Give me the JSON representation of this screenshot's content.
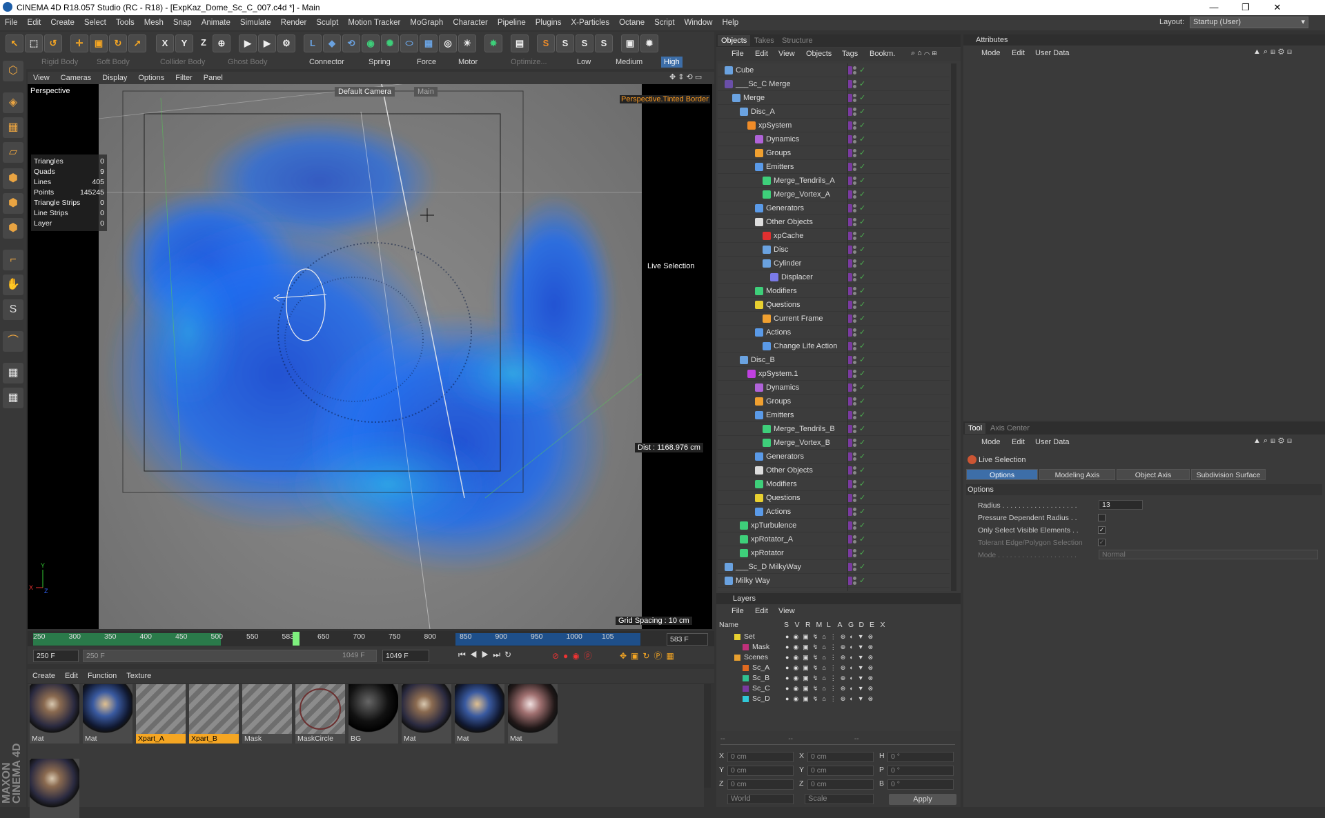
{
  "window": {
    "title": "CINEMA 4D R18.057 Studio (RC - R18) - [ExpKaz_Dome_Sc_C_007.c4d *] - Main"
  },
  "menu": [
    "File",
    "Edit",
    "Create",
    "Select",
    "Tools",
    "Mesh",
    "Snap",
    "Animate",
    "Simulate",
    "Render",
    "Sculpt",
    "Motion Tracker",
    "MoGraph",
    "Character",
    "Pipeline",
    "Plugins",
    "X-Particles",
    "Octane",
    "Script",
    "Window",
    "Help"
  ],
  "layout": {
    "label": "Layout:",
    "value": "Startup (User)"
  },
  "toolbar2": {
    "rigid_body": "Rigid Body",
    "soft_body": "Soft Body",
    "collider_body": "Collider Body",
    "ghost_body": "Ghost Body",
    "connector": "Connector",
    "spring": "Spring",
    "force": "Force",
    "motor": "Motor",
    "optimize": "Optimize...",
    "low": "Low",
    "medium": "Medium",
    "high": "High"
  },
  "viewport": {
    "menu": [
      "View",
      "Cameras",
      "Display",
      "Options",
      "Filter",
      "Panel"
    ],
    "name": "Perspective",
    "camera": "Default Camera",
    "main_label": "Main",
    "border_label": "Perspective.Tinted Border",
    "tool_hint": "Live Selection",
    "distance": "Dist : 1168.976 cm",
    "grid_spacing": "Grid Spacing : 10 cm",
    "stats": [
      {
        "label": "Triangles",
        "value": "0"
      },
      {
        "label": "Quads",
        "value": "9"
      },
      {
        "label": "Lines",
        "value": "405"
      },
      {
        "label": "Points",
        "value": "145245"
      },
      {
        "label": "Triangle Strips",
        "value": "0"
      },
      {
        "label": "Line Strips",
        "value": "0"
      },
      {
        "label": "Layer",
        "value": "0"
      }
    ]
  },
  "timeline": {
    "ticks": [
      "250",
      "300",
      "350",
      "400",
      "450",
      "500",
      "550",
      "583",
      "650",
      "700",
      "750",
      "800",
      "850",
      "900",
      "950",
      "1000",
      "105"
    ],
    "current_frame": "583 F",
    "start": "250 F",
    "range_start": "250 F",
    "range_end": "1049 F",
    "end": "1049 F"
  },
  "materials": {
    "menu": [
      "Create",
      "Edit",
      "Function",
      "Texture"
    ],
    "items": [
      {
        "name": "Mat",
        "selected": false,
        "style": "galaxy"
      },
      {
        "name": "Mat",
        "selected": false,
        "style": "galaxy-blue"
      },
      {
        "name": "Xpart_A",
        "selected": true,
        "style": "hatch"
      },
      {
        "name": "Xpart_B",
        "selected": true,
        "style": "hatch"
      },
      {
        "name": "Mask",
        "selected": false,
        "style": "hatch"
      },
      {
        "name": "MaskCircle",
        "selected": false,
        "style": "hatch-ring"
      },
      {
        "name": "BG",
        "selected": false,
        "style": "black"
      },
      {
        "name": "Mat",
        "selected": false,
        "style": "galaxy"
      },
      {
        "name": "Mat",
        "selected": false,
        "style": "galaxy-blue"
      },
      {
        "name": "Mat",
        "selected": false,
        "style": "galaxy-red"
      },
      {
        "name": "",
        "selected": false,
        "style": "galaxy"
      }
    ]
  },
  "objects_panel": {
    "tabs": [
      "Objects",
      "Takes",
      "Structure"
    ],
    "menu": [
      "File",
      "Edit",
      "View",
      "Objects",
      "Tags",
      "Bookm."
    ],
    "tree": [
      {
        "name": "Cube",
        "depth": 0,
        "icon": "#6aa2e0"
      },
      {
        "name": "___Sc_C Merge",
        "depth": 0,
        "icon": "#6a4fa8"
      },
      {
        "name": "Merge",
        "depth": 1,
        "icon": "#6aa2e0"
      },
      {
        "name": "Disc_A",
        "depth": 2,
        "icon": "#6aa2e0"
      },
      {
        "name": "xpSystem",
        "depth": 3,
        "icon": "#f08c28"
      },
      {
        "name": "Dynamics",
        "depth": 4,
        "icon": "#b063d8"
      },
      {
        "name": "Groups",
        "depth": 4,
        "icon": "#f0a030"
      },
      {
        "name": "Emitters",
        "depth": 4,
        "icon": "#5a9ae8"
      },
      {
        "name": "Merge_Tendrils_A",
        "depth": 5,
        "icon": "#3ecf7a"
      },
      {
        "name": "Merge_Vortex_A",
        "depth": 5,
        "icon": "#3ecf7a"
      },
      {
        "name": "Generators",
        "depth": 4,
        "icon": "#5a9ae8"
      },
      {
        "name": "Other Objects",
        "depth": 4,
        "icon": "#dddddd"
      },
      {
        "name": "xpCache",
        "depth": 5,
        "icon": "#e03030"
      },
      {
        "name": "Disc",
        "depth": 5,
        "icon": "#6aa2e0"
      },
      {
        "name": "Cylinder",
        "depth": 5,
        "icon": "#6aa2e0"
      },
      {
        "name": "Displacer",
        "depth": 6,
        "icon": "#7a7ae8"
      },
      {
        "name": "Modifiers",
        "depth": 4,
        "icon": "#3ecf7a"
      },
      {
        "name": "Questions",
        "depth": 4,
        "icon": "#e8d030"
      },
      {
        "name": "Current Frame",
        "depth": 5,
        "icon": "#f0a030"
      },
      {
        "name": "Actions",
        "depth": 4,
        "icon": "#5a9ae8"
      },
      {
        "name": "Change Life Action",
        "depth": 5,
        "icon": "#5a9ae8"
      },
      {
        "name": "Disc_B",
        "depth": 2,
        "icon": "#6aa2e0"
      },
      {
        "name": "xpSystem.1",
        "depth": 3,
        "icon": "#c040e0"
      },
      {
        "name": "Dynamics",
        "depth": 4,
        "icon": "#b063d8"
      },
      {
        "name": "Groups",
        "depth": 4,
        "icon": "#f0a030"
      },
      {
        "name": "Emitters",
        "depth": 4,
        "icon": "#5a9ae8"
      },
      {
        "name": "Merge_Tendrils_B",
        "depth": 5,
        "icon": "#3ecf7a"
      },
      {
        "name": "Merge_Vortex_B",
        "depth": 5,
        "icon": "#3ecf7a"
      },
      {
        "name": "Generators",
        "depth": 4,
        "icon": "#5a9ae8"
      },
      {
        "name": "Other Objects",
        "depth": 4,
        "icon": "#dddddd"
      },
      {
        "name": "Modifiers",
        "depth": 4,
        "icon": "#3ecf7a"
      },
      {
        "name": "Questions",
        "depth": 4,
        "icon": "#e8d030"
      },
      {
        "name": "Actions",
        "depth": 4,
        "icon": "#5a9ae8"
      },
      {
        "name": "xpTurbulence",
        "depth": 2,
        "icon": "#3ecf7a"
      },
      {
        "name": "xpRotator_A",
        "depth": 2,
        "icon": "#3ecf7a"
      },
      {
        "name": "xpRotator",
        "depth": 2,
        "icon": "#3ecf7a"
      },
      {
        "name": "___Sc_D MilkyWay",
        "depth": 0,
        "icon": "#6aa2e0"
      },
      {
        "name": "Milky Way",
        "depth": 0,
        "icon": "#6aa2e0"
      }
    ]
  },
  "layers_panel": {
    "title": "Layers",
    "menu": [
      "File",
      "Edit",
      "View"
    ],
    "columns": [
      "Name",
      "S",
      "V",
      "R",
      "M",
      "L",
      "A",
      "G",
      "D",
      "E",
      "X"
    ],
    "rows": [
      {
        "name": "Set",
        "color": "#e8d030",
        "depth": 0
      },
      {
        "name": "Mask",
        "color": "#c0307a",
        "depth": 1
      },
      {
        "name": "Scenes",
        "color": "#e8a030",
        "depth": 0
      },
      {
        "name": "Sc_A",
        "color": "#e06a20",
        "depth": 1
      },
      {
        "name": "Sc_B",
        "color": "#30c090",
        "depth": 1
      },
      {
        "name": "Sc_C",
        "color": "#7a3aa0",
        "depth": 1
      },
      {
        "name": "Sc_D",
        "color": "#30c8d8",
        "depth": 1
      }
    ]
  },
  "coordinates": {
    "rows": [
      {
        "a": "X",
        "a_val": "0 cm",
        "b": "X",
        "b_val": "0 cm",
        "c": "H",
        "c_val": "0 °"
      },
      {
        "a": "Y",
        "a_val": "0 cm",
        "b": "Y",
        "b_val": "0 cm",
        "c": "P",
        "c_val": "0 °"
      },
      {
        "a": "Z",
        "a_val": "0 cm",
        "b": "Z",
        "b_val": "0 cm",
        "c": "B",
        "c_val": "0 °"
      }
    ],
    "mode1": "World",
    "mode2": "Scale",
    "apply": "Apply"
  },
  "attributes_panel": {
    "title": "Attributes",
    "menu": [
      "Mode",
      "Edit",
      "User Data"
    ]
  },
  "tool_panel": {
    "tabs": [
      "Tool",
      "Axis Center"
    ],
    "menu": [
      "Mode",
      "Edit",
      "User Data"
    ],
    "tool_name": "Live Selection",
    "subtabs": [
      "Options",
      "Modeling Axis",
      "Object Axis",
      "Subdivision Surface"
    ],
    "section": "Options",
    "radius_label": "Radius . . . . . . . . . . . . . . . . . . .",
    "radius_value": "13",
    "pressure_label": "Pressure Dependent Radius . .",
    "visible_label": "Only Select Visible Elements . .",
    "tolerant_label": "Tolerant Edge/Polygon Selection",
    "mode_label": "Mode . . . . . . . . . . . . . . . . . . . .",
    "mode_value": "Normal"
  }
}
